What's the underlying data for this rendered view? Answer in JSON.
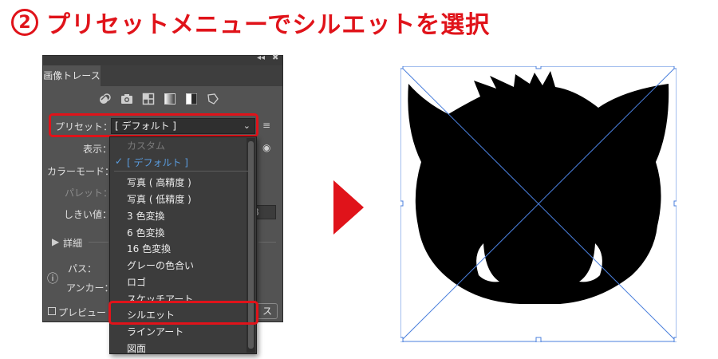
{
  "heading": {
    "step": "2",
    "text": "プリセットメニューでシルエットを選択"
  },
  "panel": {
    "collapse_glyph": "◂◂",
    "close_glyph": "✖",
    "tab": "画像トレース",
    "icons": [
      "auto-color-icon",
      "photo-icon",
      "grid-icon",
      "grayscale-icon",
      "black-white-icon",
      "outline-icon"
    ],
    "preset_label": "プリセット：",
    "preset_value": "[ デフォルト ]",
    "display_label": "表示：",
    "color_mode_label": "カラーモード：",
    "palette_label": "パレット：",
    "threshold_label": "しきい値：",
    "threshold_value": "8",
    "details_label": "詳細",
    "path_label": "パス：",
    "anchor_label": "アンカー：",
    "preview_label": "プレビュー",
    "trace_button_partial": "ス"
  },
  "dropdown": {
    "items": [
      {
        "label": "カスタム",
        "state": "disabled"
      },
      {
        "label": "[ デフォルト ]",
        "state": "selected"
      },
      {
        "label": "写真 ( 高精度 )",
        "state": "normal"
      },
      {
        "label": "写真 ( 低精度 )",
        "state": "normal"
      },
      {
        "label": "3 色変換",
        "state": "normal"
      },
      {
        "label": "6 色変換",
        "state": "normal"
      },
      {
        "label": "16 色変換",
        "state": "normal"
      },
      {
        "label": "グレーの色合い",
        "state": "normal"
      },
      {
        "label": "ロゴ",
        "state": "normal"
      },
      {
        "label": "スケッチアート",
        "state": "normal"
      },
      {
        "label": "シルエット",
        "state": "highlighted"
      },
      {
        "label": "ラインアート",
        "state": "normal"
      },
      {
        "label": "図面",
        "state": "normal"
      }
    ]
  },
  "colors": {
    "accent_red": "#e0131a",
    "selection_blue": "#4a7fdc",
    "panel_bg": "#535353",
    "menu_bg": "#3c3c3c"
  }
}
